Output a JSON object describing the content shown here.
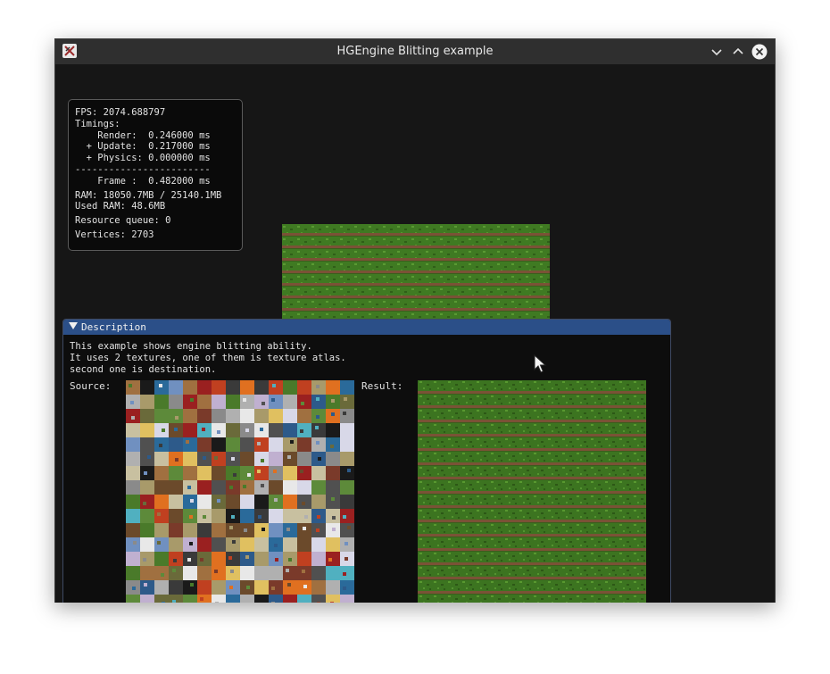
{
  "window": {
    "title": "HGEngine Blitting example"
  },
  "stats": {
    "fps": "FPS: 2074.688797",
    "timings": "Timings:",
    "render": "    Render:  0.246000 ms",
    "update": "  + Update:  0.217000 ms",
    "physics": "  + Physics: 0.000000 ms",
    "separator": "------------------------",
    "frame": "    Frame :  0.482000 ms",
    "ram": "RAM: 18050.7MB / 25140.1MB",
    "used_ram": "Used RAM: 48.6MB",
    "resource_queue": "Resource queue: 0",
    "vertices": "Vertices: 2703"
  },
  "panel": {
    "title": "Description",
    "lines": [
      "This example shows engine blitting ability.",
      "It uses 2 textures, one of them is texture atlas.",
      "second one is destination."
    ],
    "source_label": "Source:",
    "result_label": "Result:"
  },
  "icons": {
    "app": "app-icon",
    "minimize": "chevron-down-icon",
    "maximize": "chevron-up-icon",
    "close": "close-icon",
    "collapse": "triangle-down-icon",
    "cursor": "mouse-pointer-icon"
  },
  "colors": {
    "panel_header": "#2b4f88",
    "window_bg": "#161616",
    "grass": "#3f7a22",
    "dirt": "#7a5236"
  }
}
